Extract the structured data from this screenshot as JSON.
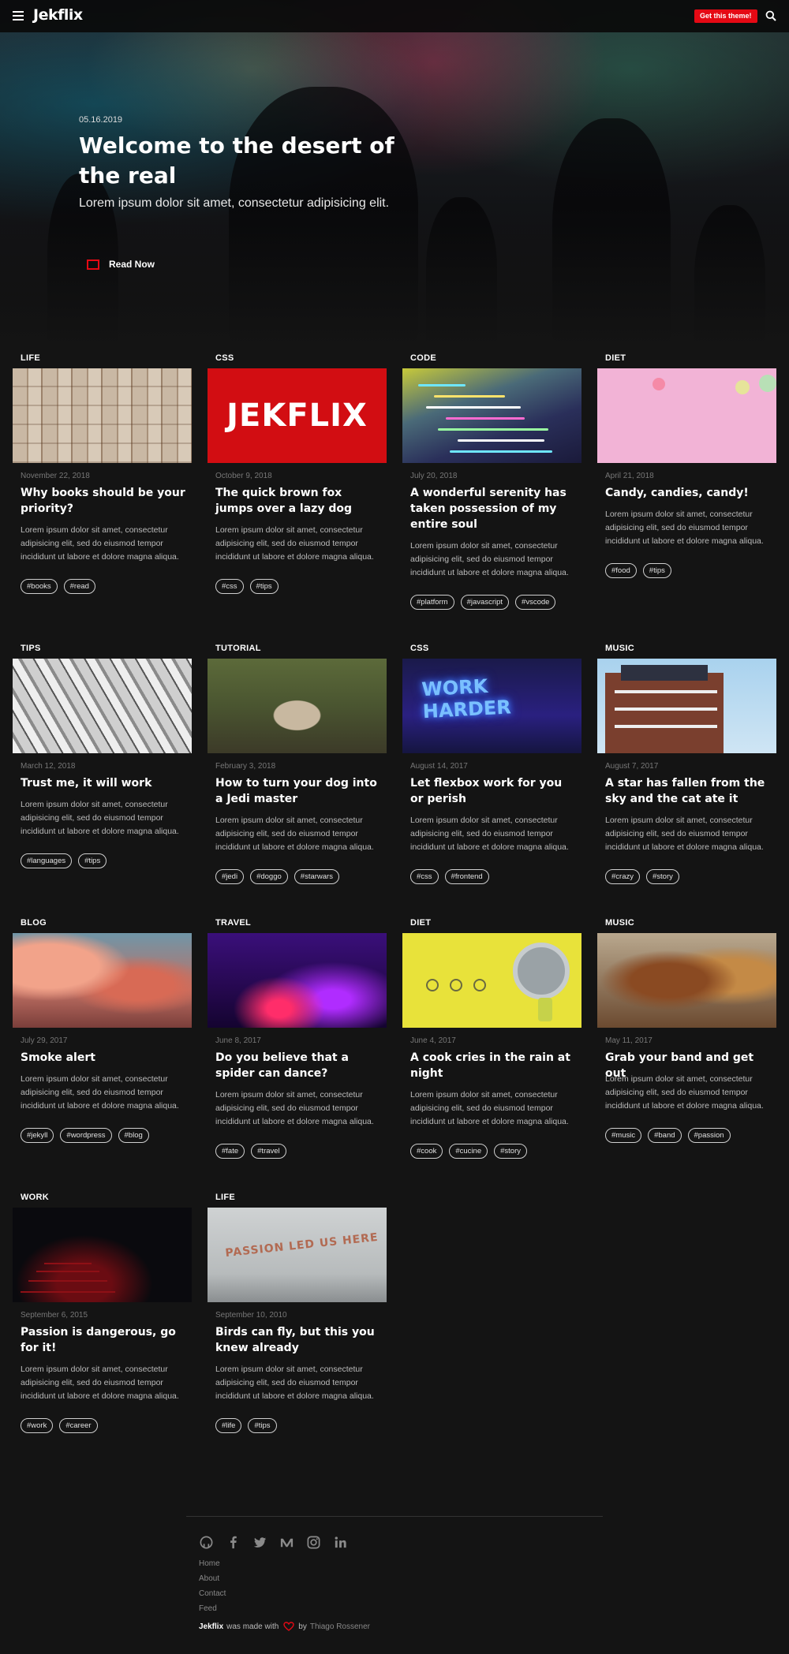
{
  "header": {
    "logo": "Jekflix",
    "theme_button": "Get this theme!",
    "accent": "#e50914",
    "icons": [
      "menu-icon",
      "search-icon"
    ]
  },
  "hero": {
    "date": "05.16.2019",
    "title": "Welcome to the desert of the real",
    "subtitle": "Lorem ipsum dolor sit amet, consectetur adipisicing elit.",
    "cta": "Read Now"
  },
  "posts": [
    {
      "category": "LIFE",
      "date": "November 22, 2018",
      "title": "Why books should be your priority?",
      "excerpt": "Lorem ipsum dolor sit amet, consectetur adipisicing elit, sed do eiusmod tempor incididunt ut labore et dolore magna aliqua.",
      "tags": [
        "#books",
        "#read"
      ]
    },
    {
      "category": "CSS",
      "date": "October 9, 2018",
      "title": "The quick brown fox jumps over a lazy dog",
      "excerpt": "Lorem ipsum dolor sit amet, consectetur adipisicing elit, sed do eiusmod tempor incididunt ut labore et dolore magna aliqua.",
      "tags": [
        "#css",
        "#tips"
      ],
      "image_text": "JEKFLIX"
    },
    {
      "category": "CODE",
      "date": "July 20, 2018",
      "title": "A wonderful serenity has taken possession of my entire soul",
      "excerpt": "Lorem ipsum dolor sit amet, consectetur adipisicing elit, sed do eiusmod tempor incididunt ut labore et dolore magna aliqua.",
      "tags": [
        "#platform",
        "#javascript",
        "#vscode"
      ]
    },
    {
      "category": "DIET",
      "date": "April 21, 2018",
      "title": "Candy, candies, candy!",
      "excerpt": "Lorem ipsum dolor sit amet, consectetur adipisicing elit, sed do eiusmod tempor incididunt ut labore et dolore magna aliqua.",
      "tags": [
        "#food",
        "#tips"
      ]
    },
    {
      "category": "TIPS",
      "date": "March 12, 2018",
      "title": "Trust me, it will work",
      "excerpt": "Lorem ipsum dolor sit amet, consectetur adipisicing elit, sed do eiusmod tempor incididunt ut labore et dolore magna aliqua.",
      "tags": [
        "#languages",
        "#tips"
      ]
    },
    {
      "category": "TUTORIAL",
      "date": "February 3, 2018",
      "title": "How to turn your dog into a Jedi master",
      "excerpt": "Lorem ipsum dolor sit amet, consectetur adipisicing elit, sed do eiusmod tempor incididunt ut labore et dolore magna aliqua.",
      "tags": [
        "#jedi",
        "#doggo",
        "#starwars"
      ]
    },
    {
      "category": "CSS",
      "date": "August 14, 2017",
      "title": "Let flexbox work for you or perish",
      "excerpt": "Lorem ipsum dolor sit amet, consectetur adipisicing elit, sed do eiusmod tempor incididunt ut labore et dolore magna aliqua.",
      "tags": [
        "#css",
        "#frontend"
      ],
      "image_text": "WORK HARDER"
    },
    {
      "category": "MUSIC",
      "date": "August 7, 2017",
      "title": "A star has fallen from the sky and the cat ate it",
      "excerpt": "Lorem ipsum dolor sit amet, consectetur adipisicing elit, sed do eiusmod tempor incididunt ut labore et dolore magna aliqua.",
      "tags": [
        "#crazy",
        "#story"
      ]
    },
    {
      "category": "BLOG",
      "date": "July 29, 2017",
      "title": "Smoke alert",
      "excerpt": "Lorem ipsum dolor sit amet, consectetur adipisicing elit, sed do eiusmod tempor incididunt ut labore et dolore magna aliqua.",
      "tags": [
        "#jekyll",
        "#wordpress",
        "#blog"
      ]
    },
    {
      "category": "TRAVEL",
      "date": "June 8, 2017",
      "title": "Do you believe that a spider can dance?",
      "excerpt": "Lorem ipsum dolor sit amet, consectetur adipisicing elit, sed do eiusmod tempor incididunt ut labore et dolore magna aliqua.",
      "tags": [
        "#fate",
        "#travel"
      ]
    },
    {
      "category": "DIET",
      "date": "June 4, 2017",
      "title": "A cook cries in the rain at night",
      "excerpt": "Lorem ipsum dolor sit amet, consectetur adipisicing elit, sed do eiusmod tempor incididunt ut labore et dolore magna aliqua.",
      "tags": [
        "#cook",
        "#cucine",
        "#story"
      ]
    },
    {
      "category": "MUSIC",
      "date": "May 11, 2017",
      "title": "Grab your band and get out",
      "excerpt": "Lorem ipsum dolor sit amet, consectetur adipisicing elit, sed do eiusmod tempor incididunt ut labore et dolore magna aliqua.",
      "tags": [
        "#music",
        "#band",
        "#passion"
      ]
    },
    {
      "category": "WORK",
      "date": "September 6, 2015",
      "title": "Passion is dangerous, go for it!",
      "excerpt": "Lorem ipsum dolor sit amet, consectetur adipisicing elit, sed do eiusmod tempor incididunt ut labore et dolore magna aliqua.",
      "tags": [
        "#work",
        "#career"
      ]
    },
    {
      "category": "LIFE",
      "date": "September 10, 2010",
      "title": "Birds can fly, but this you knew already",
      "excerpt": "Lorem ipsum dolor sit amet, consectetur adipisicing elit, sed do eiusmod tempor incididunt ut labore et dolore magna aliqua.",
      "tags": [
        "#life",
        "#tips"
      ],
      "image_text": "PASSION LED US HERE"
    }
  ],
  "footer": {
    "social_icons": [
      "github-icon",
      "facebook-icon",
      "twitter-icon",
      "medium-icon",
      "instagram-icon",
      "linkedin-icon"
    ],
    "links": [
      "Home",
      "About",
      "Contact",
      "Feed"
    ],
    "credit": {
      "brand": "Jekflix",
      "made_with": "was made with",
      "by": "by",
      "author": "Thiago Rossener"
    }
  }
}
